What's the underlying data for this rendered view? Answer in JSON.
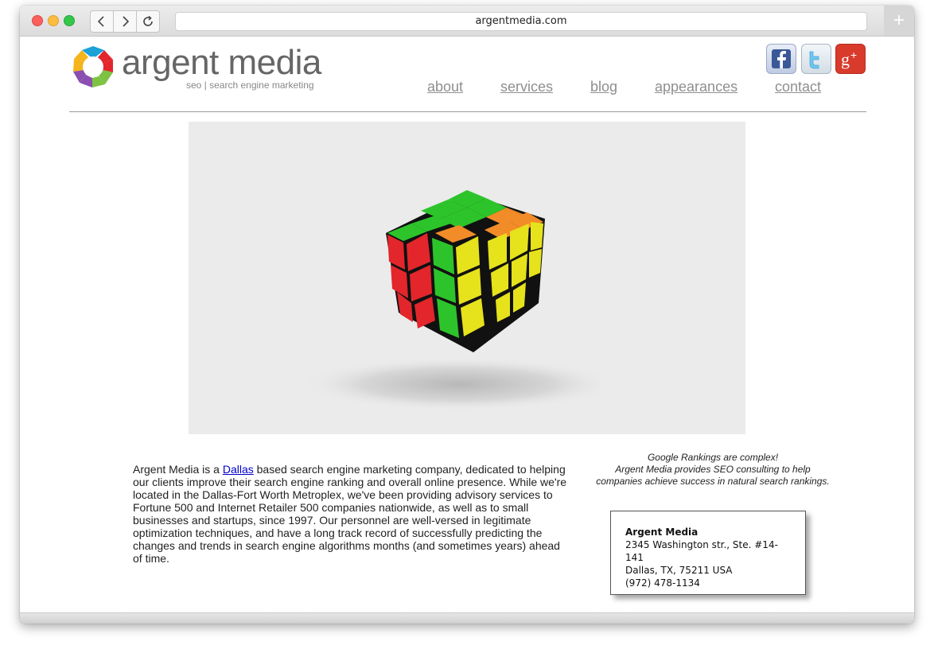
{
  "browser": {
    "url": "argentmedia.com",
    "new_tab": "+"
  },
  "brand": {
    "name": "argent media",
    "tagline": "seo | search engine marketing",
    "logo_colors": [
      "#e2262c",
      "#7dc242",
      "#3d8ed6",
      "#8a4fb0",
      "#f5a623",
      "#1aa1d8",
      "#2db34a"
    ]
  },
  "social": [
    {
      "name": "facebook",
      "glyph": "f"
    },
    {
      "name": "twitter",
      "glyph": "t"
    },
    {
      "name": "google-plus",
      "glyph": "g+"
    }
  ],
  "nav": {
    "items": [
      {
        "label": "about"
      },
      {
        "label": "services"
      },
      {
        "label": "blog"
      },
      {
        "label": "appearances"
      },
      {
        "label": "contact"
      }
    ]
  },
  "content": {
    "intro_before_link": "Argent Media is a ",
    "intro_link": "Dallas",
    "intro_after_link": " based search engine marketing company, dedicated to helping our clients improve their search engine ranking and overall online presence. While we're located in the Dallas-Fort Worth Metroplex, we've been providing advisory services to Fortune 500 and Internet Retailer 500 companies nationwide, as well as to small businesses and startups, since 1997.  Our personnel are well-versed in legitimate optimization techniques, and have a long track record of successfully predicting the changes and trends in search engine algorithms months (and sometimes years) ahead of time."
  },
  "tagline": {
    "line1": "Google Rankings are complex!",
    "line2": "Argent Media provides SEO consulting to help",
    "line3": "companies achieve success in natural search rankings."
  },
  "address": {
    "name": "Argent Media",
    "street": "2345 Washington str., Ste. #14-141",
    "city": "Dallas, TX, 75211 USA",
    "phone": "(972) 478-1134"
  }
}
